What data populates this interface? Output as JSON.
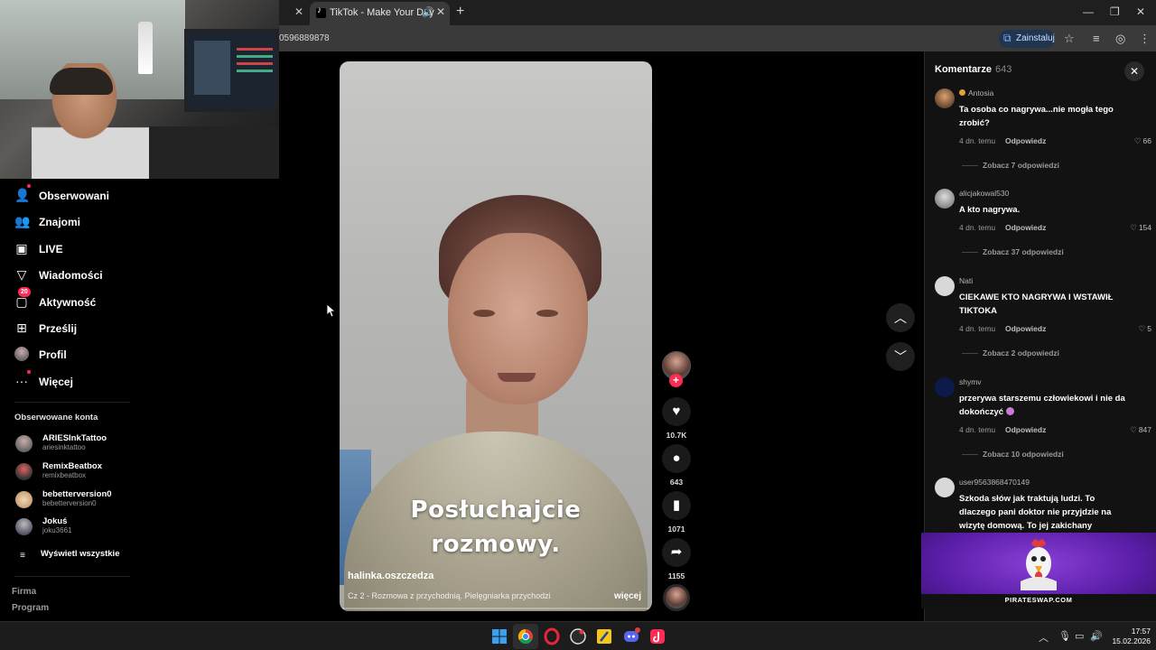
{
  "browser": {
    "tab_title": "TikTok - Make Your Day",
    "url_text": "0596889878",
    "install_label": "Zainstaluj"
  },
  "sidebar": {
    "items": [
      {
        "label": "Obserwowani",
        "icon": "following-icon"
      },
      {
        "label": "Znajomi",
        "icon": "friends-icon"
      },
      {
        "label": "LIVE",
        "icon": "live-icon"
      },
      {
        "label": "Wiadomości",
        "icon": "messages-icon"
      },
      {
        "label": "Aktywność",
        "icon": "activity-icon",
        "badge": "20"
      },
      {
        "label": "Prześlij",
        "icon": "upload-icon"
      },
      {
        "label": "Profil",
        "icon": "profile-icon"
      },
      {
        "label": "Więcej",
        "icon": "more-icon"
      }
    ],
    "followed_title": "Obserwowane konta",
    "accounts": [
      {
        "name": "ARIESInkTattoo",
        "handle": "ariesinktattoo"
      },
      {
        "name": "RemixBeatbox",
        "handle": "remixbeatbox"
      },
      {
        "name": "bebetterversion0",
        "handle": "bebetterversion0"
      },
      {
        "name": "Jokuś",
        "handle": "joku3661"
      }
    ],
    "show_all": "Wyświetl wszystkie",
    "footer": [
      "Firma",
      "Program"
    ]
  },
  "video": {
    "caption_line1": "Posłuchajcie",
    "caption_line2": "rozmowy.",
    "author": "halinka.oszczedza",
    "description": "Cz 2 - Rozmowa z przychodnią. Pielęgniarka  przychodzi",
    "more": "więcej"
  },
  "actions": {
    "likes": "10.7K",
    "comments": "643",
    "saves": "1071",
    "shares": "1155"
  },
  "comments_panel": {
    "title": "Komentarze",
    "count": "643",
    "comments": [
      {
        "user": "Antosia",
        "text": "Ta osoba co nagrywa...nie mogła tego zrobić?",
        "time": "4 dn. temu",
        "reply": "Odpowiedz",
        "likes": "66",
        "more": "Zobacz 7 odpowiedzi"
      },
      {
        "user": "alicjakowal530",
        "text": "A kto nagrywa.",
        "time": "4 dn. temu",
        "reply": "Odpowiedz",
        "likes": "154",
        "more": "Zobacz 37 odpowiedzi"
      },
      {
        "user": "Nati",
        "text": "CIEKAWE KTO NAGRYWA I WSTAWIŁ TIKTOKA",
        "time": "4 dn. temu",
        "reply": "Odpowiedz",
        "likes": "5",
        "more": "Zobacz 2 odpowiedzi"
      },
      {
        "user": "shymv",
        "text": "przerywa starszemu człowiekowi i nie da dokończyć",
        "time": "4 dn. temu",
        "reply": "Odpowiedz",
        "likes": "847",
        "more": "Zobacz 10 odpowiedzi"
      },
      {
        "user": "user9563868470149",
        "text": "Szkoda słów jak traktują ludzi. To dlaczego pani doktor nie przyjdzie na wizytę domową. To jej zakichany"
      }
    ]
  },
  "ad": {
    "text": "PIRATESWAP.COM"
  },
  "taskbar": {
    "time": "17:57",
    "date": "15.02.2026"
  },
  "colors": {
    "accent": "#fe2c55",
    "background": "#000000",
    "panel": "#121212"
  }
}
